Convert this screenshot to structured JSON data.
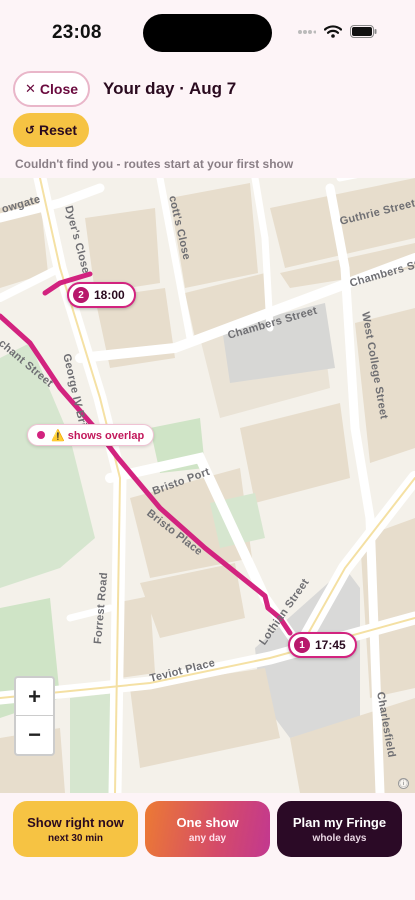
{
  "status": {
    "time": "23:08"
  },
  "header": {
    "close_label": "Close",
    "title": "Your day · Aug 7",
    "reset_label": "Reset",
    "location_message": "Couldn't find you - routes start at your first show"
  },
  "map": {
    "streets": {
      "cowgate": "owgate",
      "dyers_close": "Dyer's Close",
      "scotts_close": "cott's Close",
      "guthrie": "Guthrie Street",
      "chambers_top": "Chambers Stre",
      "chambers": "Chambers Street",
      "west_college": "West College Street",
      "george_iv": "George IV Bri",
      "merchant": "chant Street",
      "bristo_port": "Bristo Port",
      "bristo_place": "Bristo Place",
      "forrest": "Forrest Road",
      "lothian": "Lothian Street",
      "teviot": "Teviot Place",
      "charlesfield": "Charlesfield"
    },
    "pins": [
      {
        "number": "2",
        "time": "18:00"
      },
      {
        "number": "1",
        "time": "17:45"
      }
    ],
    "overlap_label": "⚠️ shows overlap",
    "zoom_in": "+",
    "zoom_out": "−",
    "attribution_icon": "ⓘ",
    "route_color": "#d2237f"
  },
  "actions": [
    {
      "label": "Show right now",
      "sub": "next 30 min"
    },
    {
      "label": "One show",
      "sub": "any day"
    },
    {
      "label": "Plan my Fringe",
      "sub": "whole days"
    }
  ]
}
